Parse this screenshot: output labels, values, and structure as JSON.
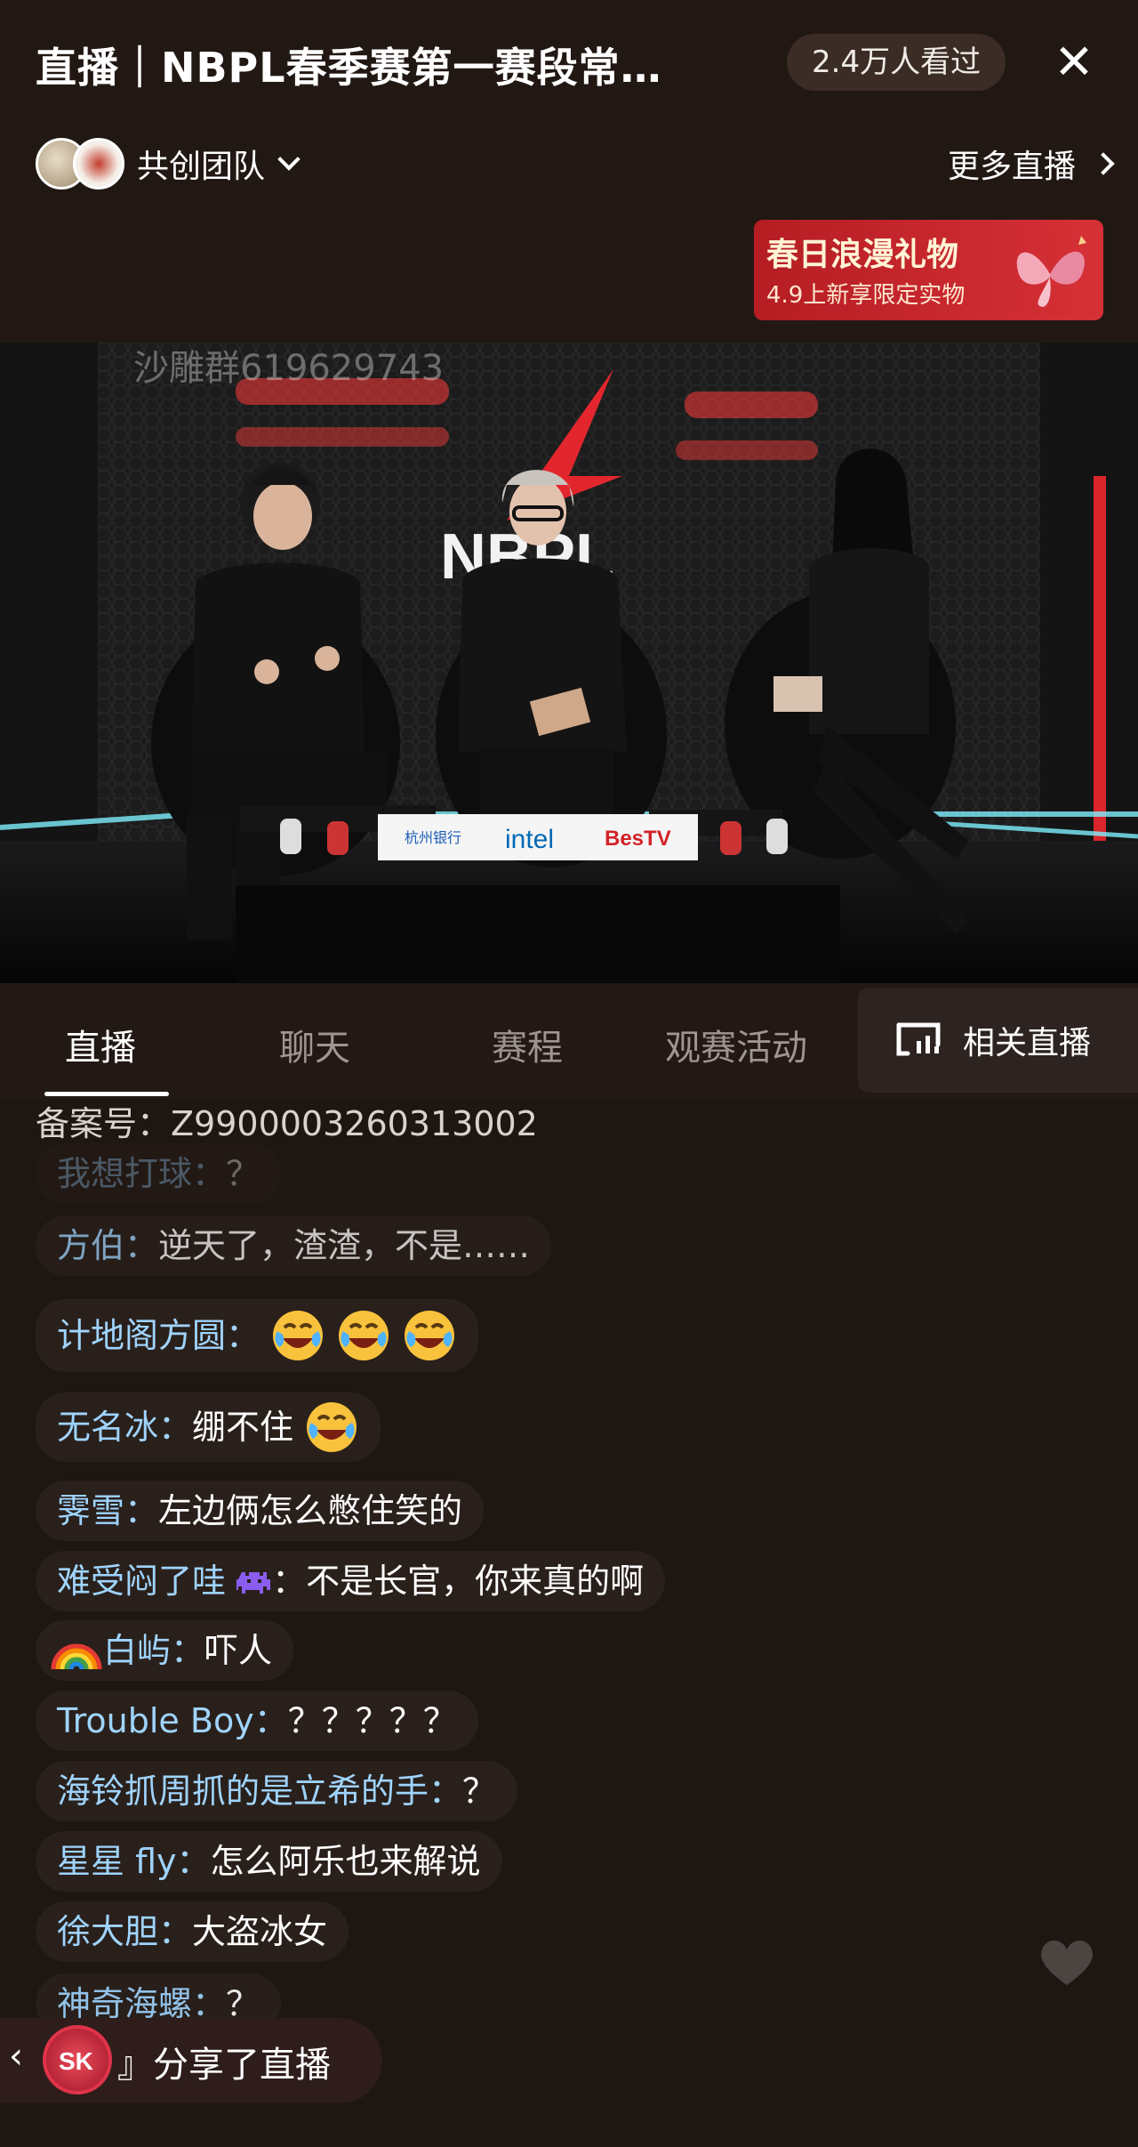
{
  "header": {
    "title": "直播｜NBPL春季赛第一赛段常…",
    "viewers": "2.4万人看过",
    "team_name": "共创团队",
    "more_live": "更多直播",
    "promo_title": "春日浪漫礼物",
    "promo_sub": "4.9上新享限定实物"
  },
  "video": {
    "watermark": "沙雕群619629743",
    "stage_logo": "NBPL",
    "sponsors": [
      "杭州银行",
      "intel",
      "BesTV"
    ]
  },
  "tabs": [
    {
      "label": "直播",
      "active": true
    },
    {
      "label": "聊天",
      "active": false
    },
    {
      "label": "赛程",
      "active": false
    },
    {
      "label": "观赛活动",
      "active": false
    }
  ],
  "related_live": "相关直播",
  "record_no": "备案号：Z9900003260313002",
  "chat": [
    {
      "nick": "我想打球：",
      "text": "？"
    },
    {
      "nick": "方伯：",
      "text": "逆天了，渣渣，不是……"
    },
    {
      "nick": "计地阁方圆：",
      "text": ""
    },
    {
      "nick": "无名冰：",
      "text": "绷不住"
    },
    {
      "nick": "霁雪：",
      "text": "左边俩怎么憋住笑的"
    },
    {
      "nick": "难受闷了哇",
      "text": "：不是长官，你来真的啊"
    },
    {
      "nick": "白屿：",
      "text": "吓人"
    },
    {
      "nick": "Trouble Boy：",
      "text": "？？？？？"
    },
    {
      "nick": "海铃抓周抓的是立希的手：",
      "text": "？"
    },
    {
      "nick": "星星 fly：",
      "text": "怎么阿乐也来解说"
    },
    {
      "nick": "徐大胆：",
      "text": "大盗冰女"
    },
    {
      "nick": "神奇海螺：",
      "text": "？"
    }
  ],
  "share": {
    "text": "』分享了直播",
    "avatar_text": "SK"
  },
  "colors": {
    "background": "#1e1612",
    "nick": "#9fd4ff",
    "promo": "#c9252b",
    "share_ring": "#e0344a"
  }
}
